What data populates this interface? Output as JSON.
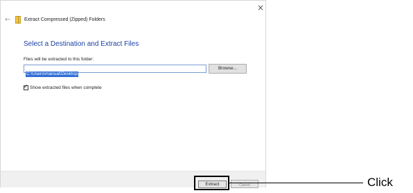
{
  "dialog": {
    "close_glyph": "×",
    "back_glyph": "←",
    "icon": "zip-folder-icon",
    "title": "Extract Compressed (Zipped) Folders",
    "heading": "Select a Destination and Extract Files",
    "folder_label": "Files will be extracted to this folder:",
    "path_value": "C:\\Users\\manual\\Desktop",
    "browse_label": "Browse...",
    "show_files_checked": true,
    "checkbox_glyph": "✓",
    "show_files_label": "Show extracted files when complete",
    "extract_label": "Extract",
    "cancel_label": "Cancel"
  },
  "annotation": {
    "callout_text": "Click"
  },
  "colors": {
    "heading": "#1a3fa6",
    "selection": "#2f6dd5",
    "input_border": "#7a9cd3",
    "footer": "#f0f0f0"
  }
}
